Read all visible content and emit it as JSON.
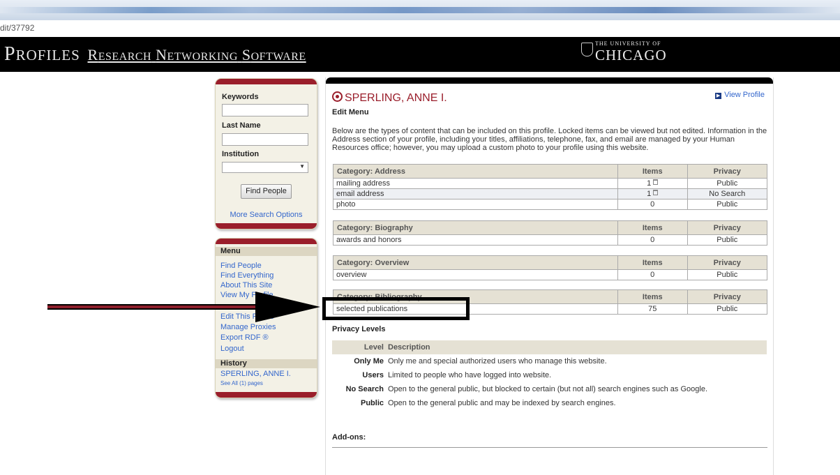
{
  "browser": {
    "url_fragment": "dit/37792"
  },
  "header": {
    "brand_p": "P",
    "brand_rofiles": "ROFILES",
    "brand_r": "R",
    "brand_esearch": "ESEARCH",
    "brand_n": "N",
    "brand_etworking": "ETWORKING",
    "brand_s": "S",
    "brand_oftware": "OFTWARE",
    "uc_line1": "THE UNIVERSITY OF",
    "uc_line2": "CHICAGO"
  },
  "search_panel": {
    "keywords_label": "Keywords",
    "keywords_value": "",
    "lastname_label": "Last Name",
    "lastname_value": "",
    "institution_label": "Institution",
    "institution_value": "",
    "find_button": "Find People",
    "more_options": "More Search Options"
  },
  "menu_panel": {
    "heading": "Menu",
    "items": [
      "Find People",
      "Find Everything",
      "About This Site",
      "View My Profile",
      "Edit This Profile",
      "Manage Proxies",
      "Export RDF ®",
      "Logout"
    ],
    "history_heading": "History",
    "history_item": "SPERLING, ANNE I.",
    "see_all": "See All (1) pages"
  },
  "main": {
    "person_name": "SPERLING, ANNE I.",
    "view_profile": "View Profile",
    "edit_menu": "Edit Menu",
    "description": "Below are the types of content that can be included on this profile. Locked items can be viewed but not edited. Information in the Address section of your profile, including your titles, affiliations, telephone, fax, and email are managed by your Human Resources office; however, you may upload a custom photo to your profile using this website.",
    "col_items": "Items",
    "col_privacy": "Privacy",
    "categories": [
      {
        "name": "Category: Address",
        "rows": [
          {
            "label": "mailing address",
            "items": "1",
            "privacy": "Public",
            "locked": true
          },
          {
            "label": "email address",
            "items": "1",
            "privacy": "No Search",
            "locked": true
          },
          {
            "label": "photo",
            "items": "0",
            "privacy": "Public",
            "locked": false
          }
        ]
      },
      {
        "name": "Category: Biography",
        "rows": [
          {
            "label": "awards and honors",
            "items": "0",
            "privacy": "Public",
            "locked": false
          }
        ]
      },
      {
        "name": "Category: Overview",
        "rows": [
          {
            "label": "overview",
            "items": "0",
            "privacy": "Public",
            "locked": false
          }
        ]
      },
      {
        "name": "Category: Bibliography",
        "rows": [
          {
            "label": "selected publications",
            "items": "75",
            "privacy": "Public",
            "locked": false
          }
        ]
      }
    ],
    "privacy_levels_heading": "Privacy Levels",
    "privacy_header_level": "Level",
    "privacy_header_desc": "Description",
    "privacy_levels": [
      {
        "level": "Only Me",
        "desc": "Only me and special authorized users who manage this website."
      },
      {
        "level": "Users",
        "desc": "Limited to people who have logged into website."
      },
      {
        "level": "No Search",
        "desc": "Open to the general public, but blocked to certain (but not all) search engines such as Google."
      },
      {
        "level": "Public",
        "desc": "Open to the general public and may be indexed by search engines."
      }
    ],
    "addons_heading": "Add-ons:"
  },
  "annotation": {
    "arrow_color": "#8e1f2c",
    "box_color": "#000000"
  }
}
